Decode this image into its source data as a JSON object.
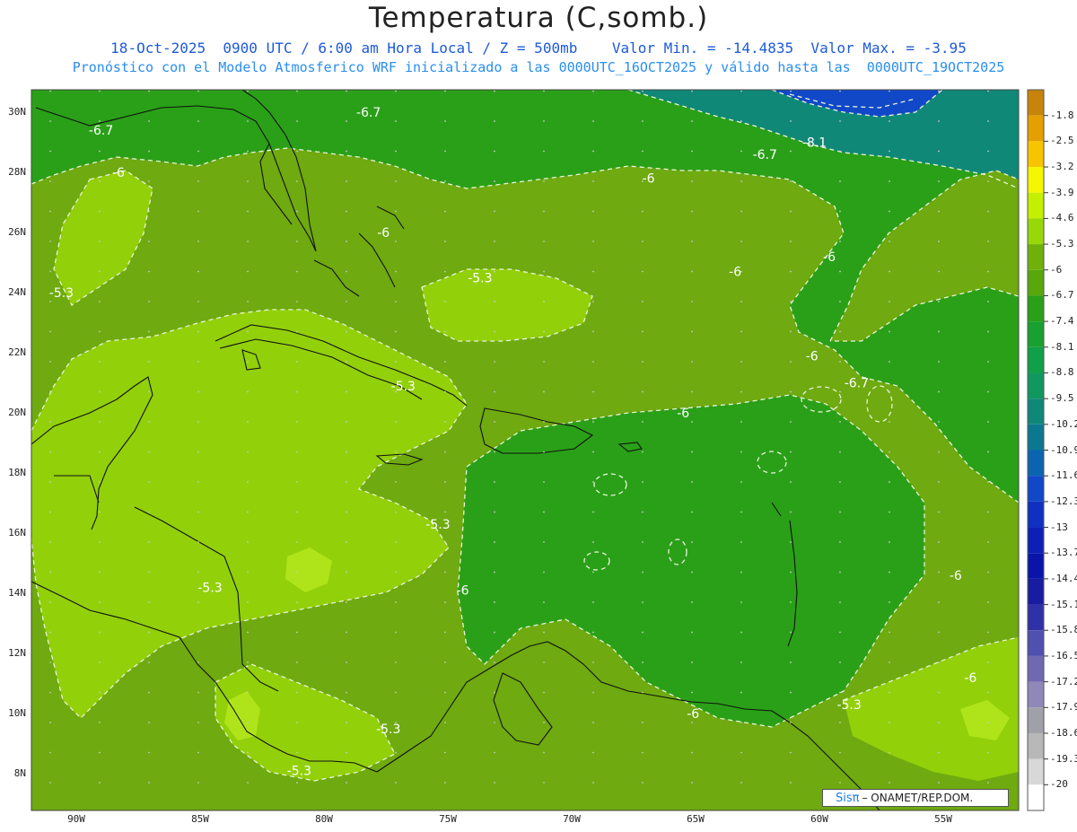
{
  "header": {
    "title": "Temperatura (C,somb.)",
    "subtitle_1": "18-Oct-2025  0900 UTC / 6:00 am Hora Local / Z = 500mb    Valor Min. = -14.4835  Valor Max. = -3.95",
    "subtitle_2": "Pronóstico con el Modelo Atmosferico WRF inicializado a las 0000UTC_16OCT2025 y válido hasta las  0000UTC_19OCT2025"
  },
  "axes": {
    "lat_labels": [
      "30N",
      "28N",
      "26N",
      "24N",
      "22N",
      "20N",
      "18N",
      "16N",
      "14N",
      "12N",
      "10N",
      "8N"
    ],
    "lon_labels": [
      "90W",
      "85W",
      "80W",
      "75W",
      "70W",
      "65W",
      "60W",
      "55W"
    ]
  },
  "colorbar": {
    "labels": [
      "-1.8",
      "-2.5",
      "-3.2",
      "-3.9",
      "-4.6",
      "-5.3",
      "-6",
      "-6.7",
      "-7.4",
      "-8.1",
      "-8.8",
      "-9.5",
      "-10.2",
      "-10.9",
      "-11.6",
      "-12.3",
      "-13",
      "-13.7",
      "-14.4",
      "-15.1",
      "-15.8",
      "-16.5",
      "-17.2",
      "-17.9",
      "-18.6",
      "-19.3",
      "-20"
    ],
    "colors": [
      "#c8840a",
      "#e4a000",
      "#f8c400",
      "#f6f600",
      "#c4f000",
      "#98d808",
      "#70b00a",
      "#58a80c",
      "#2aa018",
      "#18a030",
      "#10a048",
      "#109860",
      "#108878",
      "#0c7890",
      "#0c64b0",
      "#1048c8",
      "#1030c0",
      "#0c20b8",
      "#0a14a8",
      "#181ca0",
      "#3030a8",
      "#5050b0",
      "#7068b0",
      "#9088b8",
      "#a0a0a8",
      "#b8b8b8",
      "#d8d8d8",
      "#ffffff"
    ]
  },
  "contour_labels": [
    {
      "text": "-6.7",
      "lon": -78.2,
      "lat": 30.0
    },
    {
      "text": "-6.7",
      "lon": -89.0,
      "lat": 29.4
    },
    {
      "text": "-8.1",
      "lon": -60.2,
      "lat": 29.0
    },
    {
      "text": "-6.7",
      "lon": -62.2,
      "lat": 28.6
    },
    {
      "text": "-6",
      "lon": -88.3,
      "lat": 28.0
    },
    {
      "text": "-6",
      "lon": -66.9,
      "lat": 27.8
    },
    {
      "text": "-6",
      "lon": -77.6,
      "lat": 26.0
    },
    {
      "text": "-6",
      "lon": -59.6,
      "lat": 25.2
    },
    {
      "text": "-6",
      "lon": -63.4,
      "lat": 24.7
    },
    {
      "text": "-5.3",
      "lon": -90.6,
      "lat": 24.0
    },
    {
      "text": "-5.3",
      "lon": -73.7,
      "lat": 24.5
    },
    {
      "text": "-6",
      "lon": -60.3,
      "lat": 21.9
    },
    {
      "text": "-6.7",
      "lon": -58.5,
      "lat": 21.0
    },
    {
      "text": "-5.3",
      "lon": -76.8,
      "lat": 20.9
    },
    {
      "text": "-6",
      "lon": -65.5,
      "lat": 20.0
    },
    {
      "text": "-5.3",
      "lon": -75.4,
      "lat": 16.3
    },
    {
      "text": "-6",
      "lon": -54.5,
      "lat": 14.6
    },
    {
      "text": "-5.3",
      "lon": -84.6,
      "lat": 14.2
    },
    {
      "text": "-6",
      "lon": -74.4,
      "lat": 14.1
    },
    {
      "text": "-6",
      "lon": -53.9,
      "lat": 11.2
    },
    {
      "text": "-6",
      "lon": -65.1,
      "lat": 10.0
    },
    {
      "text": "-5.3",
      "lon": -58.8,
      "lat": 10.3
    },
    {
      "text": "-5.3",
      "lon": -77.4,
      "lat": 9.5
    },
    {
      "text": "-5.3",
      "lon": -81.0,
      "lat": 8.1
    }
  ],
  "credit": {
    "brand": "Sisπ",
    "org": "– ONAMET/REP.DOM."
  }
}
